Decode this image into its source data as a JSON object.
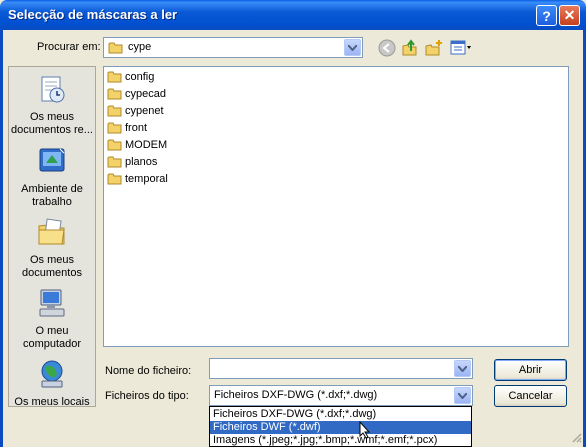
{
  "window": {
    "title": "Selecção de máscaras a ler",
    "help_label": "?",
    "close_label": "✕"
  },
  "lookin": {
    "label": "Procurar em:",
    "value": "cype"
  },
  "places": [
    {
      "label": "Os meus documentos re...",
      "icon": "recent-documents-icon"
    },
    {
      "label": "Ambiente de trabalho",
      "icon": "desktop-icon"
    },
    {
      "label": "Os meus documentos",
      "icon": "my-documents-icon"
    },
    {
      "label": "O meu computador",
      "icon": "my-computer-icon"
    },
    {
      "label": "Os meus locais",
      "icon": "network-places-icon"
    }
  ],
  "folders": [
    "config",
    "cypecad",
    "cypenet",
    "front",
    "MODEM",
    "planos",
    "temporal"
  ],
  "filename": {
    "label": "Nome do ficheiro:",
    "value": ""
  },
  "filetype": {
    "label": "Ficheiros do tipo:",
    "value": "Ficheiros DXF-DWG (*.dxf;*.dwg)",
    "options": [
      "Ficheiros DXF-DWG (*.dxf;*.dwg)",
      "Ficheiros DWF (*.dwf)",
      "Imagens (*.jpeg;*.jpg;*.bmp;*.wmf;*.emf;*.pcx)"
    ],
    "highlighted_index": 1
  },
  "buttons": {
    "open": "Abrir",
    "cancel": "Cancelar"
  },
  "colors": {
    "titlebar": "#0a5ad6",
    "selection": "#316ac5",
    "folder": "#f4d26a"
  }
}
